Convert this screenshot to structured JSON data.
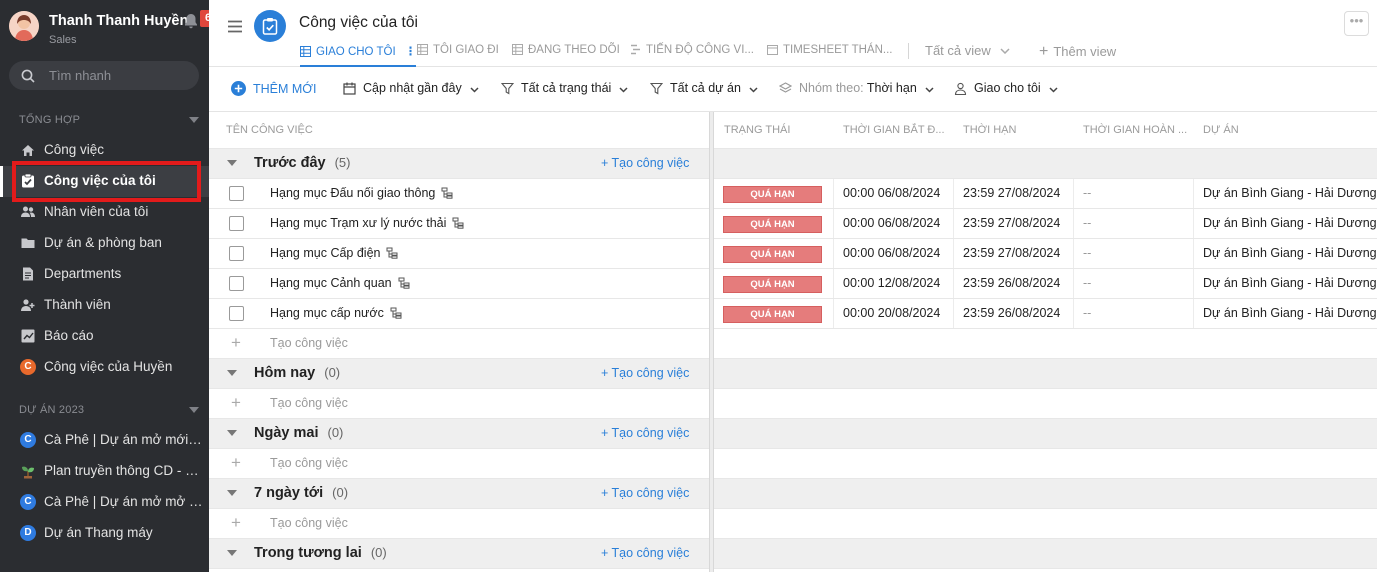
{
  "sidebar": {
    "user": {
      "name": "Thanh Thanh Huyền",
      "role": "Sales",
      "notifications": "6"
    },
    "search_placeholder": "Tìm nhanh",
    "section1": "TỔNG HỢP",
    "items": [
      {
        "label": "Công việc",
        "icon": "home-icon"
      },
      {
        "label": "Công việc của tôi",
        "icon": "task-check-icon",
        "active": true
      },
      {
        "label": "Nhân viên của tôi",
        "icon": "people-icon"
      },
      {
        "label": "Dự án & phòng ban",
        "icon": "folder-icon"
      },
      {
        "label": "Departments",
        "icon": "document-icon"
      },
      {
        "label": "Thành viên",
        "icon": "person-icon"
      },
      {
        "label": "Báo cáo",
        "icon": "chart-icon"
      },
      {
        "label": "Công việc của Huyền",
        "icon": "c-badge-icon",
        "letter": "C"
      }
    ],
    "section2": "DỰ ÁN 2023",
    "projects": [
      {
        "label": "Cà Phê | Dự án mở mới c...",
        "letter": "C",
        "color": "#2f7be0"
      },
      {
        "label": "Plan truyền thông CD - M...",
        "letter": "",
        "color": "#5aa05a"
      },
      {
        "label": "Cà Phê | Dự án mở mở V...",
        "letter": "C",
        "color": "#2f7be0"
      },
      {
        "label": "Dự án Thang máy",
        "letter": "D",
        "color": "#2f7be0"
      }
    ]
  },
  "header": {
    "title": "Công việc của tôi",
    "tabs": [
      {
        "label": "GIAO CHO TÔI",
        "active": true
      },
      {
        "label": "TÔI GIAO ĐI"
      },
      {
        "label": "ĐANG THEO DÕI"
      },
      {
        "label": "TIẾN ĐỘ CÔNG VI..."
      },
      {
        "label": "TIMESHEET THÁN..."
      }
    ],
    "all_views": "Tất cả view",
    "add_view": "Thêm view",
    "more": "•••"
  },
  "toolbar": {
    "add_new": "THÊM MỚI",
    "sort": "Cập nhật gần đây",
    "status_filter": "Tất cả trạng thái",
    "project_filter": "Tất cả dự án",
    "group_by_label": "Nhóm theo:",
    "group_by_value": "Thời hạn",
    "assigned": "Giao cho tôi"
  },
  "columns": [
    "TÊN CÔNG VIỆC",
    "TRẠNG THÁI",
    "THỜI GIAN BẮT Đ...",
    "THỜI HẠN",
    "THỜI GIAN HOÀN ...",
    "DỰ ÁN"
  ],
  "groups": [
    {
      "name": "Trước đây",
      "count": "(5)",
      "add": "Tạo công việc"
    },
    {
      "name": "Hôm nay",
      "count": "(0)",
      "add": "Tạo công việc"
    },
    {
      "name": "Ngày mai",
      "count": "(0)",
      "add": "Tạo công việc"
    },
    {
      "name": "7 ngày tới",
      "count": "(0)",
      "add": "Tạo công việc"
    },
    {
      "name": "Trong tương lai",
      "count": "(0)",
      "add": "Tạo công việc"
    }
  ],
  "add_task_label": "Tạo công việc",
  "tasks": [
    {
      "name": "Hạng mục Đấu nối giao thông",
      "status": "QUÁ HẠN",
      "start": "00:00 06/08/2024",
      "due": "23:59 27/08/2024",
      "done": "--",
      "project": "Dự án Bình Giang - Hải Dương"
    },
    {
      "name": "Hạng mục Trạm xư lý nước thải",
      "status": "QUÁ HẠN",
      "start": "00:00 06/08/2024",
      "due": "23:59 27/08/2024",
      "done": "--",
      "project": "Dự án Bình Giang - Hải Dương"
    },
    {
      "name": "Hạng mục Cấp điện",
      "status": "QUÁ HẠN",
      "start": "00:00 06/08/2024",
      "due": "23:59 27/08/2024",
      "done": "--",
      "project": "Dự án Bình Giang - Hải Dương"
    },
    {
      "name": "Hạng mục Cảnh quan",
      "status": "QUÁ HẠN",
      "start": "00:00 12/08/2024",
      "due": "23:59 26/08/2024",
      "done": "--",
      "project": "Dự án Bình Giang - Hải Dương"
    },
    {
      "name": "Hạng mục cấp nước",
      "status": "QUÁ HẠN",
      "start": "00:00 20/08/2024",
      "due": "23:59 26/08/2024",
      "done": "--",
      "project": "Dự án Bình Giang - Hải Dương"
    }
  ],
  "colors": {
    "accent": "#2a7fd8",
    "sidebar_bg": "#2b2d31",
    "overdue": "#e57c7c",
    "highlight": "#e31b1b"
  }
}
